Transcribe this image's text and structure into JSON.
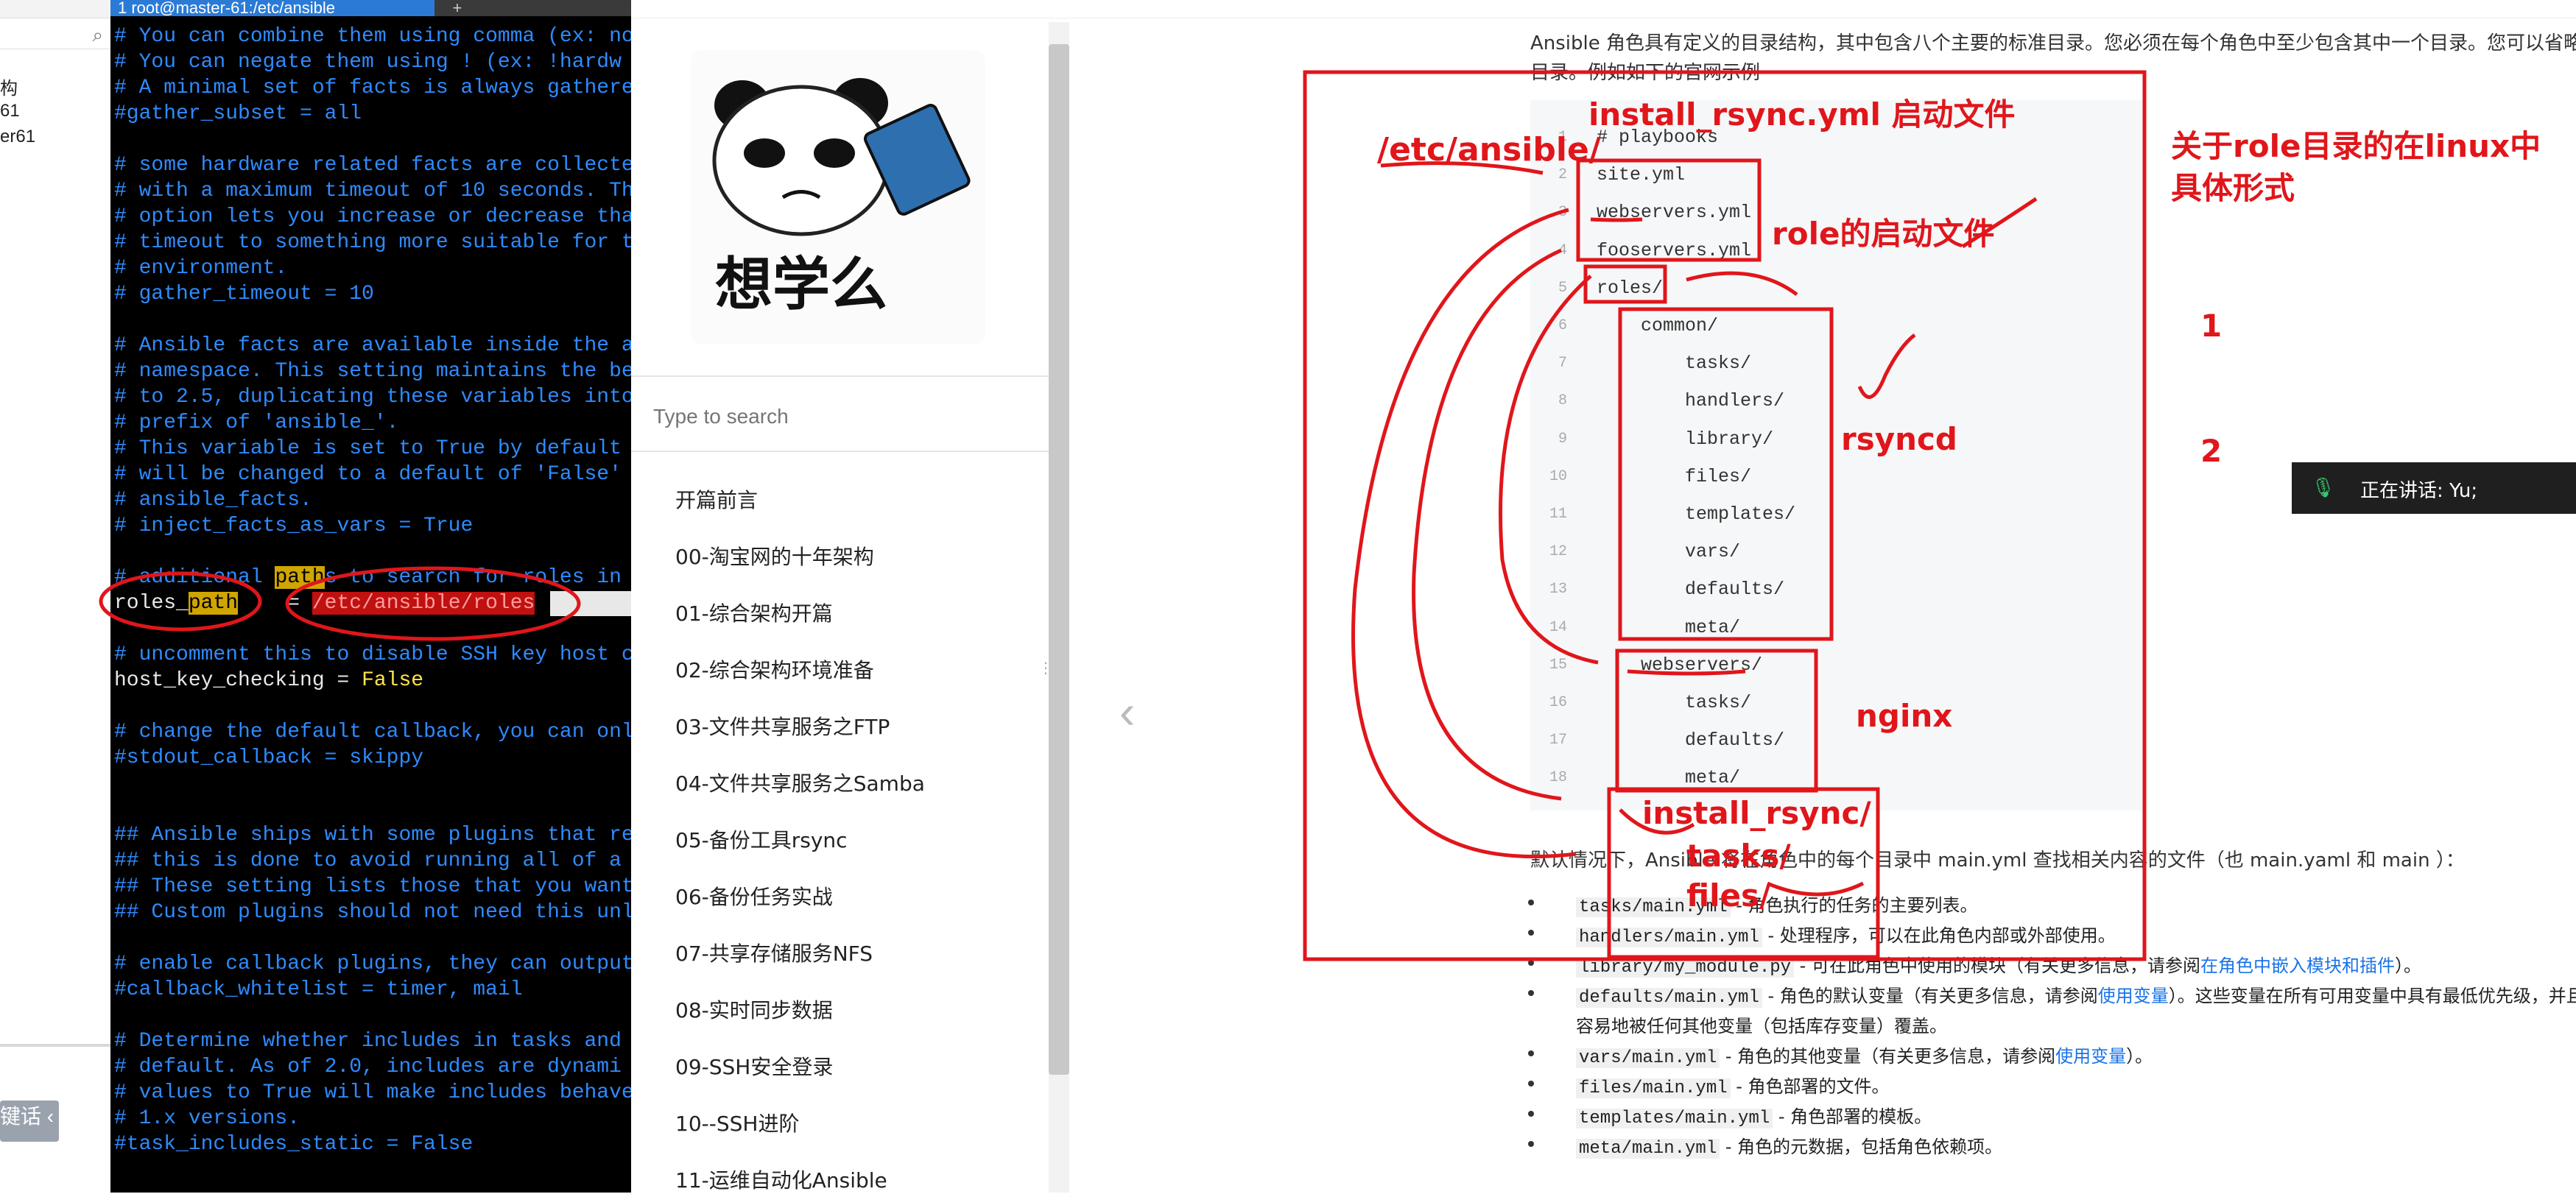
{
  "left_tree": {
    "items": [
      "构",
      "61",
      "er61"
    ],
    "bottom_button": "键话"
  },
  "terminal": {
    "tab_title": "1 root@master-61:/etc/ansible",
    "lines": [
      {
        "t": "# You can combine them using comma (ex: no",
        "c": "com"
      },
      {
        "t": "# You can negate them using ! (ex: !hardw",
        "c": "com"
      },
      {
        "t": "# A minimal set of facts is always gathere",
        "c": "com"
      },
      {
        "t": "#gather_subset = all",
        "c": "com"
      },
      {
        "t": "",
        "c": "com"
      },
      {
        "t": "# some hardware related facts are collecte",
        "c": "com"
      },
      {
        "t": "# with a maximum timeout of 10 seconds. Th",
        "c": "com"
      },
      {
        "t": "# option lets you increase or decrease tha",
        "c": "com"
      },
      {
        "t": "# timeout to something more suitable for t",
        "c": "com"
      },
      {
        "t": "# environment.",
        "c": "com"
      },
      {
        "t": "# gather_timeout = 10",
        "c": "com"
      },
      {
        "t": "",
        "c": "com"
      },
      {
        "t": "# Ansible facts are available inside the a",
        "c": "com"
      },
      {
        "t": "# namespace. This setting maintains the be",
        "c": "com"
      },
      {
        "t": "# to 2.5, duplicating these variables into",
        "c": "com"
      },
      {
        "t": "# prefix of 'ansible_'.",
        "c": "com"
      },
      {
        "t": "# This variable is set to True by default",
        "c": "com"
      },
      {
        "t": "# will be changed to a default of 'False'",
        "c": "com"
      },
      {
        "t": "# ansible_facts.",
        "c": "com"
      },
      {
        "t": "# inject_facts_as_vars = True",
        "c": "com"
      },
      {
        "t": "",
        "c": "com"
      }
    ],
    "line_additional_pre": "# additional ",
    "line_additional_hl": "path",
    "line_additional_post": "s to search for roles in",
    "roles_key": "roles_",
    "roles_key_hl": "path",
    "roles_eq": "    = ",
    "roles_value": "/etc/ansible/roles",
    "lines2": [
      {
        "t": "",
        "c": "com"
      },
      {
        "t": "# uncomment this to disable SSH key host c",
        "c": "com"
      },
      {
        "t": "host_key_checking = ",
        "c": "wh"
      },
      {
        "t": "",
        "c": "com"
      },
      {
        "t": "# change the default callback, you can onl",
        "c": "com"
      },
      {
        "t": "#stdout_callback = skippy",
        "c": "com"
      },
      {
        "t": "",
        "c": "com"
      },
      {
        "t": "",
        "c": "com"
      },
      {
        "t": "## Ansible ships with some plugins that re",
        "c": "com"
      },
      {
        "t": "## this is done to avoid running all of a",
        "c": "com"
      },
      {
        "t": "## These setting lists those that you want",
        "c": "com"
      },
      {
        "t": "## Custom plugins should not need this unl",
        "c": "com"
      },
      {
        "t": "",
        "c": "com"
      },
      {
        "t": "# enable callback plugins, they can output",
        "c": "com"
      },
      {
        "t": "#callback_whitelist = timer, mail",
        "c": "com"
      },
      {
        "t": "",
        "c": "com"
      },
      {
        "t": "# Determine whether includes in tasks and",
        "c": "com"
      },
      {
        "t": "# default. As of 2.0, includes are dynami",
        "c": "com"
      },
      {
        "t": "# values to True will make includes behave",
        "c": "com"
      },
      {
        "t": "# 1.x versions.",
        "c": "com"
      },
      {
        "t": "#task_includes_static = False",
        "c": "com"
      }
    ],
    "false_value": "False"
  },
  "toc": {
    "sticker_text": "想学么",
    "search_placeholder": "Type to search",
    "items": [
      "开篇前言",
      "00-淘宝网的十年架构",
      "01-综合架构开篇",
      "02-综合架构环境准备",
      "03-文件共享服务之FTP",
      "04-文件共享服务之Samba",
      "05-备份工具rsync",
      "06-备份任务实战",
      "07-共享存储服务NFS",
      "08-实时同步数据",
      "09-SSH安全登录",
      "10--SSH进阶",
      "11-运维自动化Ansible"
    ]
  },
  "doc": {
    "intro_line1": "Ansible 角色具有定义的目录结构，其中包含八个主要的标准目录。您必须在每个角色中至少包含其中一个目录。您可以省略角色不使",
    "intro_line2": "目录。例如如下的官网示例",
    "code_lines": [
      {
        "n": "1",
        "t": "# playbooks"
      },
      {
        "n": "2",
        "t": "site.yml"
      },
      {
        "n": "3",
        "t": "webservers.yml"
      },
      {
        "n": "4",
        "t": "fooservers.yml"
      },
      {
        "n": "5",
        "t": "roles/"
      },
      {
        "n": "6",
        "t": "    common/"
      },
      {
        "n": "7",
        "t": "        tasks/"
      },
      {
        "n": "8",
        "t": "        handlers/"
      },
      {
        "n": "9",
        "t": "        library/"
      },
      {
        "n": "10",
        "t": "        files/"
      },
      {
        "n": "11",
        "t": "        templates/"
      },
      {
        "n": "12",
        "t": "        vars/"
      },
      {
        "n": "13",
        "t": "        defaults/"
      },
      {
        "n": "14",
        "t": "        meta/"
      },
      {
        "n": "15",
        "t": "    webservers/"
      },
      {
        "n": "16",
        "t": "        tasks/"
      },
      {
        "n": "17",
        "t": "        defaults/"
      },
      {
        "n": "18",
        "t": "        meta/"
      }
    ],
    "default_text": "默认情况下，Ansible 将在角色中的每个目录中 main.yml 查找相关内容的文件（也 main.yaml 和 main ）：",
    "bullets": [
      {
        "code": "tasks/main.yml",
        "text": " - 角色执行的任务的主要列表。",
        "link": "",
        "tail": ""
      },
      {
        "code": "handlers/main.yml",
        "text": " - 处理程序，可以在此角色内部或外部使用。",
        "link": "",
        "tail": ""
      },
      {
        "code": "library/my_module.py",
        "text": " - 可在此角色中使用的模块（有关更多信息，请参阅",
        "link": "在角色中嵌入模块和插件",
        "tail": "）。"
      },
      {
        "code": "defaults/main.yml",
        "text": " - 角色的默认变量（有关更多信息，请参阅",
        "link": "使用变量",
        "tail": "）。这些变量在所有可用变量中具有最低优先级，并且"
      },
      {
        "code": "",
        "text": "容易地被任何其他变量（包括库存变量）覆盖。",
        "link": "",
        "tail": ""
      },
      {
        "code": "vars/main.yml",
        "text": " - 角色的其他变量（有关更多信息，请参阅",
        "link": "使用变量",
        "tail": "）。"
      },
      {
        "code": "files/main.yml",
        "text": " - 角色部署的文件。",
        "link": "",
        "tail": ""
      },
      {
        "code": "templates/main.yml",
        "text": " - 角色部署的模板。",
        "link": "",
        "tail": ""
      },
      {
        "code": "meta/main.yml",
        "text": " - 角色的元数据，包括角色依赖项。",
        "link": "",
        "tail": ""
      }
    ]
  },
  "meeting": {
    "text": "正在讲话: Yu;"
  },
  "annotations": {
    "install": "install_rsync.yml  启动文件",
    "etc": "/etc/ansible/",
    "role_start": "role的启动文件",
    "title": "关于role目录的在linux中",
    "title2": "具体形式",
    "one": "1",
    "two": "2",
    "rsyncd": "rsyncd",
    "nginx": "nginx",
    "install_dir": "install_rsync/",
    "tasks": "tasks/",
    "files": "files/"
  },
  "colors": {
    "annotation": "#e0161b",
    "terminal_comment": "#2e8bff",
    "link": "#1a73e8"
  }
}
